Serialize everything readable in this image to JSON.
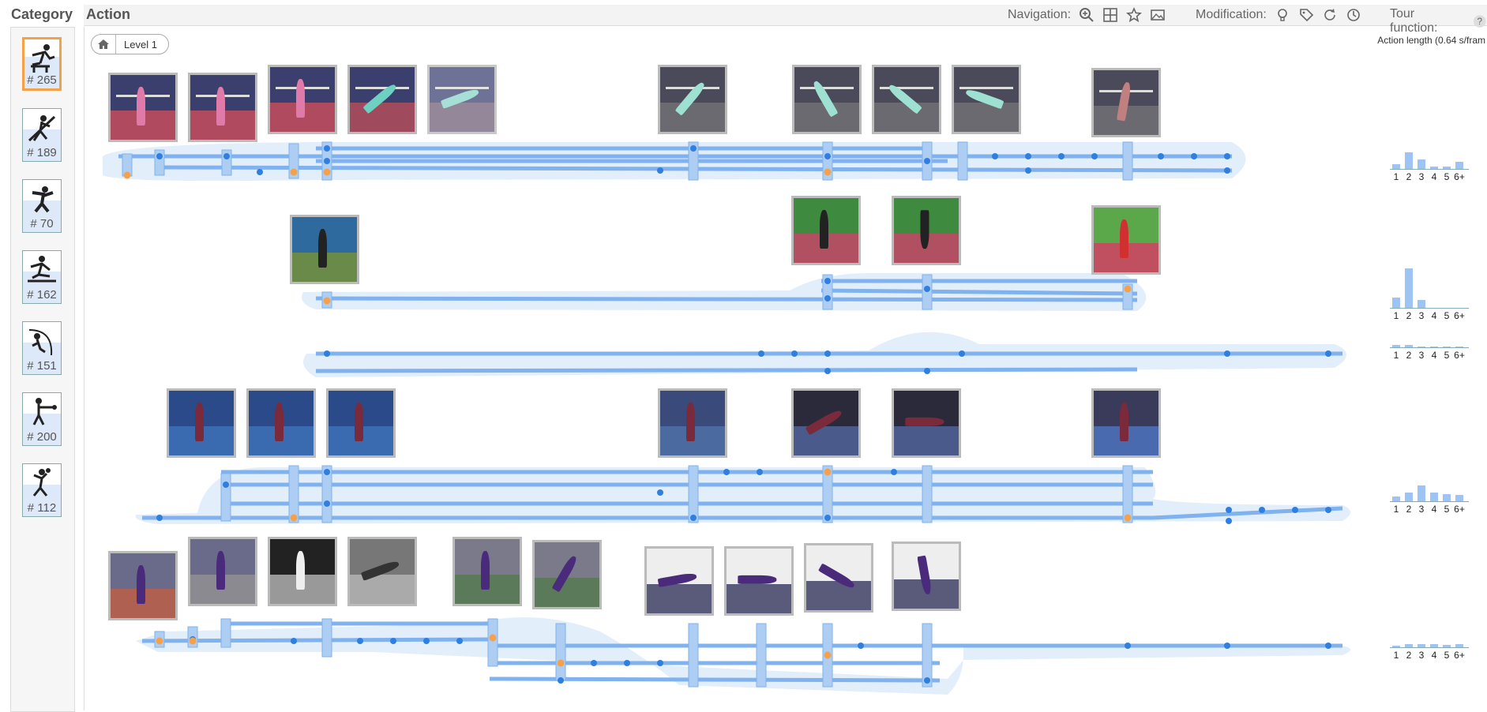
{
  "header": {
    "category_title": "Category",
    "action_title": "Action"
  },
  "toolbar": {
    "navigation_label": "Navigation:",
    "modification_label": "Modification:",
    "tour_label": "Tour function:",
    "navigation_icons": [
      "zoom-in-icon",
      "layout-icon",
      "star-icon",
      "image-icon"
    ],
    "modification_icons": [
      "lightbulb-icon",
      "tag-icon",
      "refresh-icon",
      "history-icon"
    ],
    "tour_icons": [
      "help-icon"
    ]
  },
  "categories": [
    {
      "icon": "hurdles-icon",
      "count": "# 265",
      "selected": true
    },
    {
      "icon": "javelin-icon",
      "count": "# 189"
    },
    {
      "icon": "discus-icon",
      "count": "# 70"
    },
    {
      "icon": "long-jump-icon",
      "count": "# 162"
    },
    {
      "icon": "pole-vault-icon",
      "count": "# 151"
    },
    {
      "icon": "hammer-throw-icon",
      "count": "# 200"
    },
    {
      "icon": "shot-put-icon",
      "count": "# 112"
    }
  ],
  "breadcrumb": {
    "home_icon": "home-icon",
    "level": "Level 1"
  },
  "action_length_label": "Action length (0.64 s/fram",
  "histogram_labels": [
    "1",
    "2",
    "3",
    "4",
    "5",
    "6+"
  ],
  "histograms": [
    [
      0.2,
      0.7,
      0.4,
      0.1,
      0.1,
      0.3
    ],
    [
      0.25,
      1.0,
      0.2,
      0.0,
      0.0,
      0.0
    ],
    [
      0.2,
      0.2,
      0.1,
      0.1,
      0.1,
      0.1
    ],
    [
      0.2,
      0.35,
      0.65,
      0.35,
      0.3,
      0.25
    ],
    [
      0.15,
      0.3,
      0.3,
      0.3,
      0.2,
      0.3
    ]
  ],
  "colors": {
    "accent": "#f5a14a",
    "flow": "#4a90e2",
    "band": "#e3eefb",
    "node": "#2f7fe0"
  }
}
